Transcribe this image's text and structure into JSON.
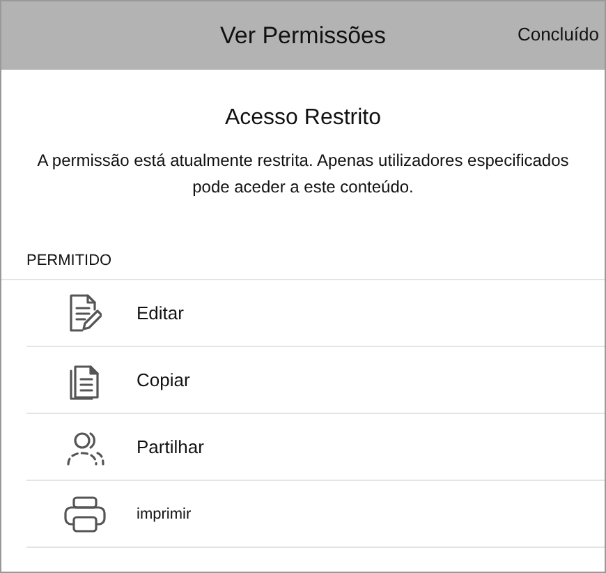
{
  "header": {
    "title": "Ver Permissões",
    "done": "Concluído"
  },
  "heading": "Acesso Restrito",
  "message": "A permissão está atualmente restrita. Apenas utilizadores especificados pode aceder a este conteúdo.",
  "section": {
    "title": "PERMITIDO",
    "items": [
      {
        "kind": "edit",
        "label": "Editar"
      },
      {
        "kind": "copy",
        "label": "Copiar"
      },
      {
        "kind": "share",
        "label": "Partilhar"
      },
      {
        "kind": "print",
        "label": "imprimir"
      }
    ]
  }
}
